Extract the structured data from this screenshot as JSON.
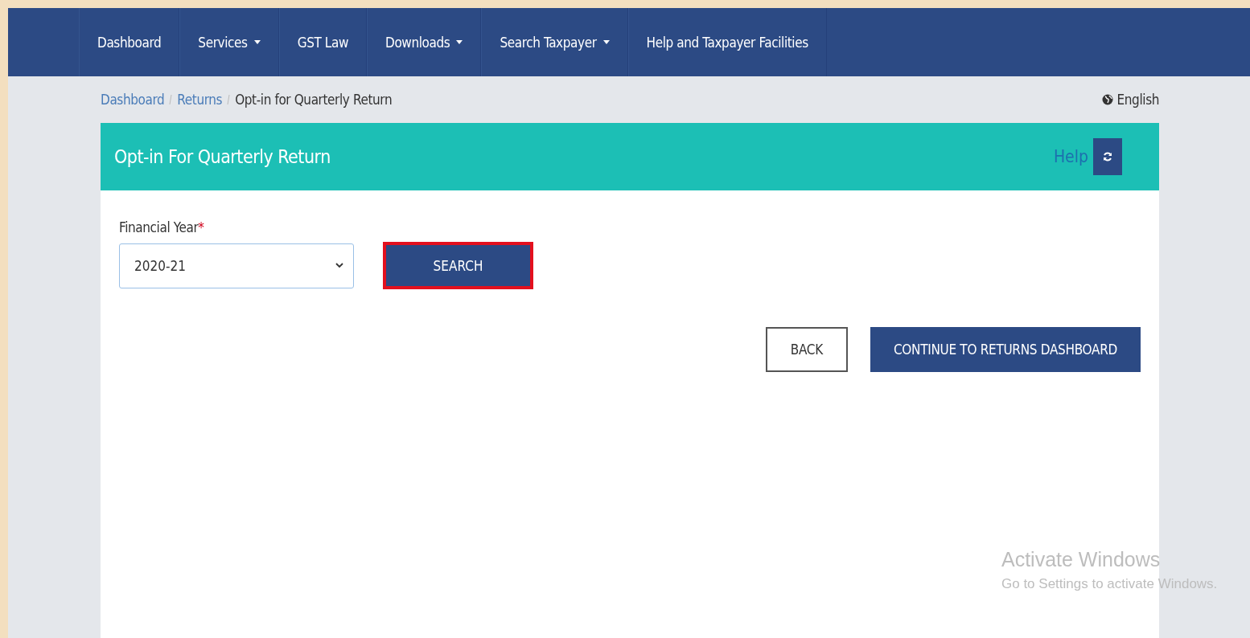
{
  "nav": {
    "items": [
      {
        "label": "Dashboard",
        "dropdown": false
      },
      {
        "label": "Services",
        "dropdown": true
      },
      {
        "label": "GST Law",
        "dropdown": false
      },
      {
        "label": "Downloads",
        "dropdown": true
      },
      {
        "label": "Search Taxpayer",
        "dropdown": true
      },
      {
        "label": "Help and Taxpayer Facilities",
        "dropdown": false
      }
    ]
  },
  "breadcrumb": [
    {
      "label": "Dashboard",
      "link": true
    },
    {
      "label": "Returns",
      "link": true
    },
    {
      "label": "Opt-in for Quarterly Return",
      "link": false
    }
  ],
  "language": "English",
  "panel": {
    "title": "Opt-in For Quarterly Return",
    "help": "Help"
  },
  "form": {
    "label": "Financial Year",
    "required": true,
    "required_mark": "*",
    "value": "2020-21",
    "search_button": {
      "label": "SEARCH",
      "highlighted": true
    }
  },
  "buttons": [
    {
      "label": "BACK",
      "kind": "secondary"
    },
    {
      "label": "CONTINUE TO RETURNS DASHBOARD",
      "kind": "primary"
    }
  ],
  "os_notice": {
    "title": "Activate Windows",
    "text": "Go to Settings to activate Windows."
  }
}
